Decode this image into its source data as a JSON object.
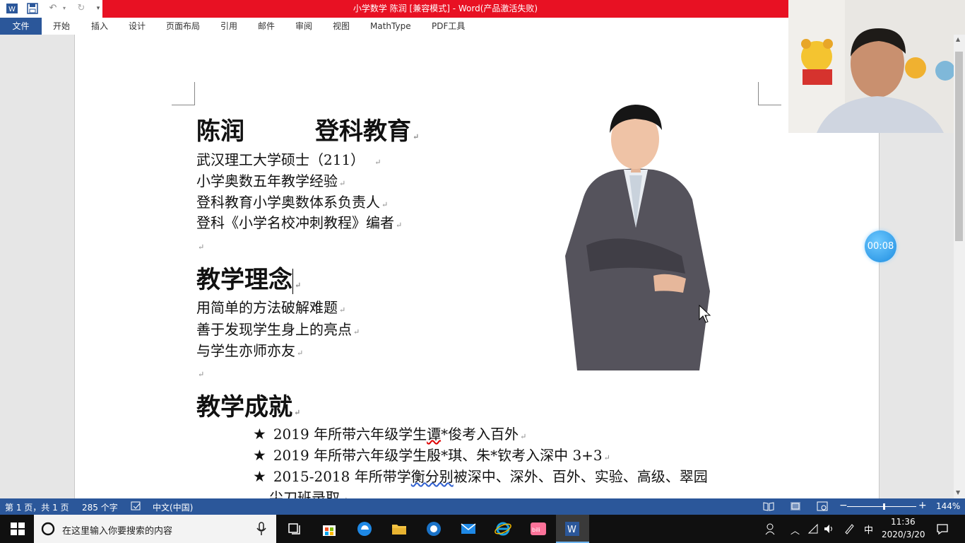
{
  "window": {
    "title": "小学数学  陈润 [兼容模式] -  Word(产品激活失败)"
  },
  "ribbon": {
    "file": "文件",
    "tabs": [
      "开始",
      "插入",
      "设计",
      "页面布局",
      "引用",
      "邮件",
      "审阅",
      "视图",
      "MathType",
      "PDF工具"
    ]
  },
  "doc": {
    "name": "陈润",
    "org": "登科教育",
    "bio": [
      "武汉理工大学硕士（211）",
      "小学奥数五年教学经验",
      "登科教育小学奥数体系负责人",
      "登科《小学名校冲刺教程》编者"
    ],
    "heading2": "教学理念",
    "ideas": [
      "用简单的方法破解难题",
      "善于发现学生身上的亮点",
      "与学生亦师亦友"
    ],
    "heading3": "教学成就",
    "achievements": [
      {
        "pre": "2019 年所带六年级学生",
        "mark": "谭",
        "post": "*俊考入百外"
      },
      {
        "pre": "2019 年所带六年级学生殷*琪、朱*钦考入深中 3+3",
        "mark": "",
        "post": ""
      },
      {
        "pre": "2015-2018 年所带学",
        "mark": "衡分别",
        "post": "被深中、深外、百外、实验、高级、翠园"
      }
    ],
    "wrap_line": "尖刀班录取",
    "star": "★",
    "para_mark": "↵"
  },
  "recorder": {
    "timer": "00:08"
  },
  "statusbar": {
    "page": "第 1 页，共 1 页",
    "words": "285 个字",
    "lang": "中文(中国)",
    "zoom": "144%",
    "zoom_level": 0.62
  },
  "taskbar": {
    "search_placeholder": "在这里输入你要搜索的内容",
    "ime": "中",
    "time": "11:36",
    "date": "2020/3/20"
  },
  "colors": {
    "word_blue": "#2b579a",
    "title_red": "#e81123",
    "taskbar": "#101010"
  }
}
